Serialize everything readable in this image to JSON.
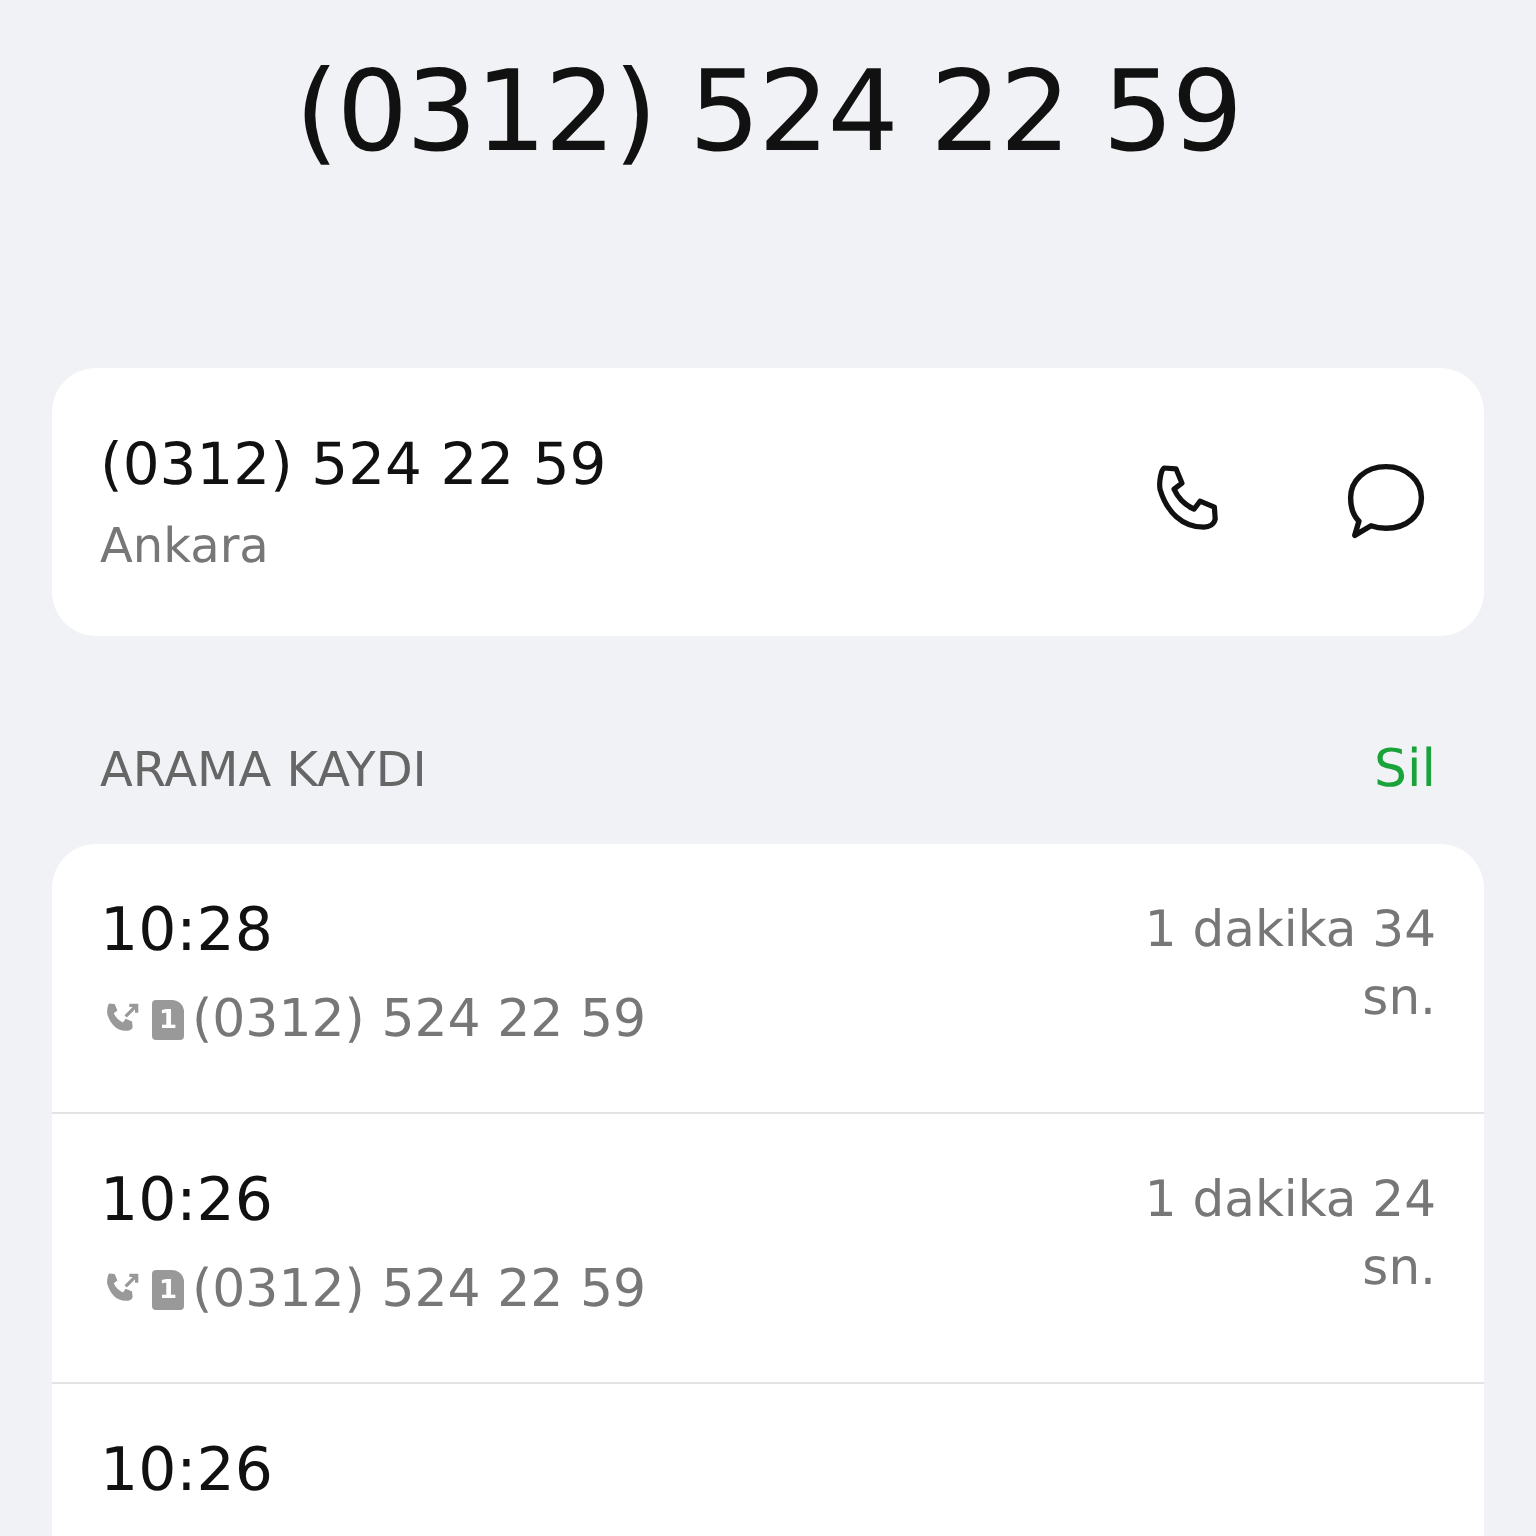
{
  "title": "(0312) 524 22 59",
  "contact": {
    "number": "(0312) 524 22 59",
    "location": "Ankara"
  },
  "section": {
    "title": "ARAMA KAYDI",
    "action": "Sil"
  },
  "calls": [
    {
      "time": "10:28",
      "sim": "1",
      "number": "(0312) 524 22 59",
      "duration": "1 dakika 34 sn."
    },
    {
      "time": "10:26",
      "sim": "1",
      "number": "(0312) 524 22 59",
      "duration": "1 dakika 24 sn."
    },
    {
      "time": "10:26"
    }
  ]
}
